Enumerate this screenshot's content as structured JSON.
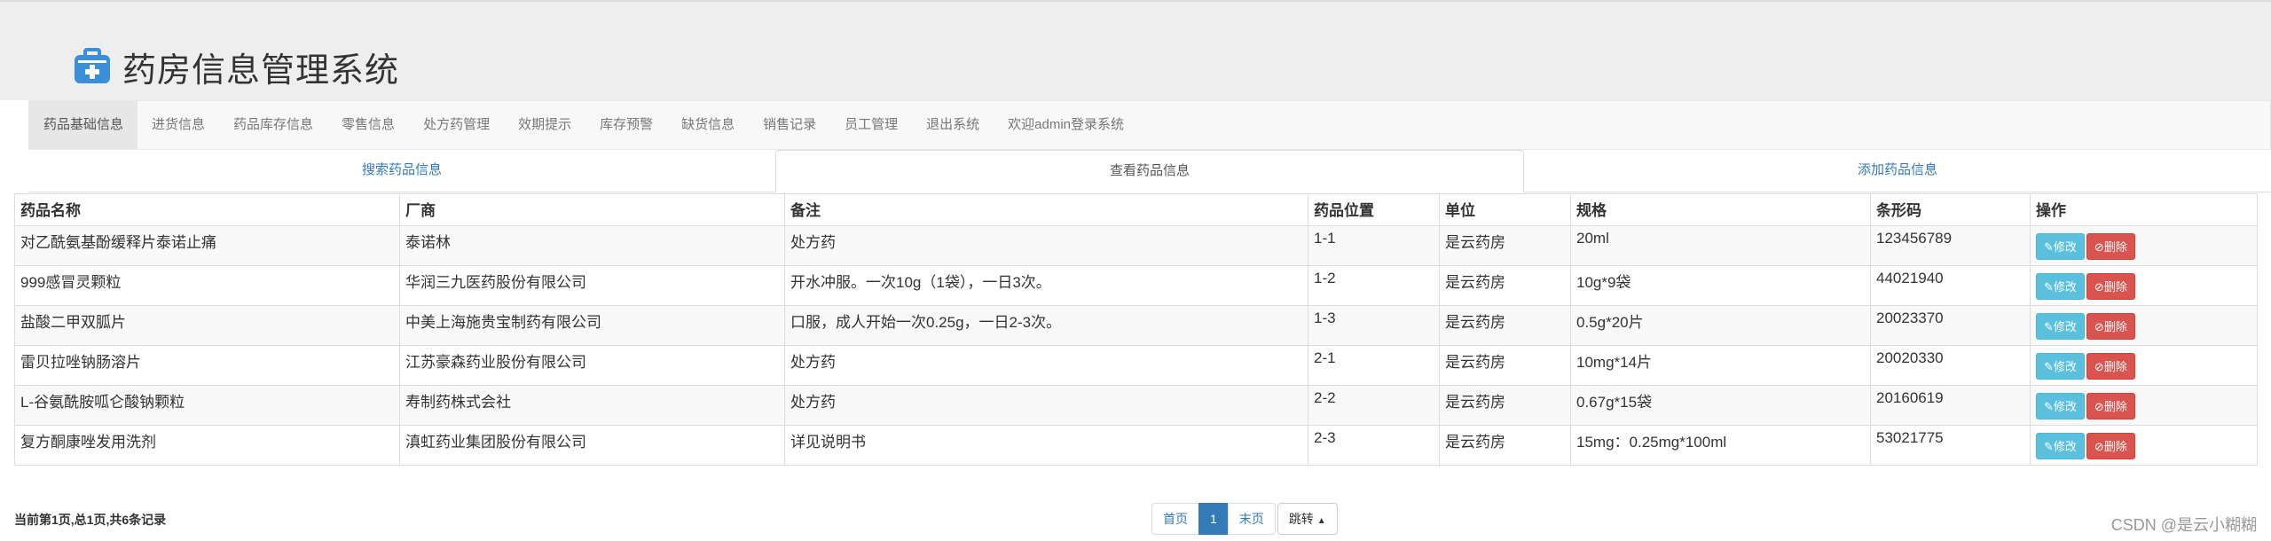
{
  "app": {
    "title": "药房信息管理系统"
  },
  "nav": {
    "items": [
      {
        "label": "药品基础信息",
        "active": true
      },
      {
        "label": "进货信息"
      },
      {
        "label": "药品库存信息"
      },
      {
        "label": "零售信息"
      },
      {
        "label": "处方药管理"
      },
      {
        "label": "效期提示"
      },
      {
        "label": "库存预警"
      },
      {
        "label": "缺货信息"
      },
      {
        "label": "销售记录"
      },
      {
        "label": "员工管理"
      },
      {
        "label": "退出系统"
      },
      {
        "label": "欢迎admin登录系统"
      }
    ]
  },
  "tabs": [
    {
      "label": "搜索药品信息"
    },
    {
      "label": "查看药品信息",
      "active": true
    },
    {
      "label": "添加药品信息"
    }
  ],
  "table": {
    "headers": [
      "药品名称",
      "厂商",
      "备注",
      "药品位置",
      "单位",
      "规格",
      "条形码",
      "操作"
    ],
    "rows": [
      [
        "对乙酰氨基酚缓释片泰诺止痛",
        "泰诺林",
        "处方药",
        "1-1",
        "是云药房",
        "20ml",
        "123456789"
      ],
      [
        "999感冒灵颗粒",
        "华润三九医药股份有限公司",
        "开水冲服。一次10g（1袋），一日3次。",
        "1-2",
        "是云药房",
        "10g*9袋",
        "44021940"
      ],
      [
        "盐酸二甲双胍片",
        "中美上海施贵宝制药有限公司",
        "口服，成人开始一次0.25g，一日2-3次。",
        "1-3",
        "是云药房",
        "0.5g*20片",
        "20023370"
      ],
      [
        "雷贝拉唑钠肠溶片",
        "江苏豪森药业股份有限公司",
        "处方药",
        "2-1",
        "是云药房",
        "10mg*14片",
        "20020330"
      ],
      [
        "L-谷氨酰胺呱仑酸钠颗粒",
        "寿制药株式会社",
        "处方药",
        "2-2",
        "是云药房",
        "0.67g*15袋",
        "20160619"
      ],
      [
        "复方酮康唑发用洗剂",
        "滇虹药业集团股份有限公司",
        "详见说明书",
        "2-3",
        "是云药房",
        "15mg：0.25mg*100ml",
        "53021775"
      ]
    ],
    "edit_label": "修改",
    "delete_label": "删除"
  },
  "footer": {
    "summary": "当前第1页,总1页,共6条记录",
    "pager": {
      "first": "首页",
      "current": "1",
      "last": "末页",
      "jump": "跳转"
    },
    "watermark": "CSDN @是云小糊糊"
  },
  "colors": {
    "primary": "#337ab7",
    "edit": "#5bc0de",
    "delete": "#d9534f",
    "brand_icon": "#3a8fd6"
  }
}
